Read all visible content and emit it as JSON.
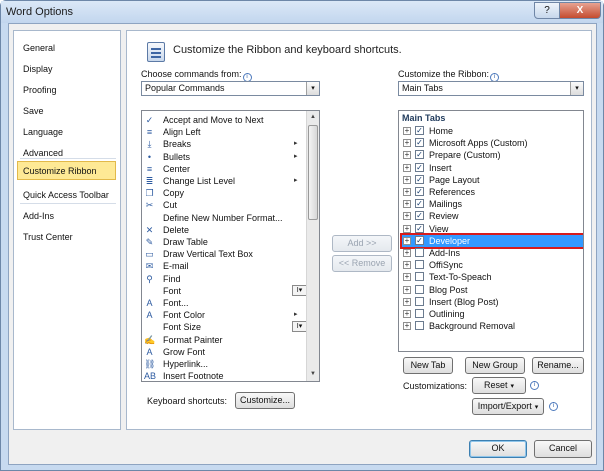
{
  "window": {
    "title": "Word Options",
    "help_glyph": "?",
    "close_glyph": "X"
  },
  "nav": {
    "items": [
      {
        "label": "General"
      },
      {
        "label": "Display"
      },
      {
        "label": "Proofing"
      },
      {
        "label": "Save"
      },
      {
        "label": "Language"
      },
      {
        "label": "Advanced"
      },
      {
        "label": "Customize Ribbon",
        "selected": true
      },
      {
        "label": "Quick Access Toolbar"
      },
      {
        "label": "Add-Ins"
      },
      {
        "label": "Trust Center"
      }
    ]
  },
  "header": {
    "title": "Customize the Ribbon and keyboard shortcuts.",
    "icon": "ribbon-customize-icon"
  },
  "left": {
    "label": "Choose commands from:",
    "info_glyph": "i",
    "selected": "Popular Commands",
    "commands": [
      {
        "label": "Accept and Move to Next",
        "icon": "accept-change-icon",
        "glyph": "✓"
      },
      {
        "label": "Align Left",
        "icon": "align-left-icon",
        "glyph": "≡"
      },
      {
        "label": "Breaks",
        "icon": "breaks-icon",
        "glyph": "⤓",
        "submenu": "▸"
      },
      {
        "label": "Bullets",
        "icon": "bullets-icon",
        "glyph": "•",
        "submenu": "▸"
      },
      {
        "label": "Center",
        "icon": "align-center-icon",
        "glyph": "≡"
      },
      {
        "label": "Change List Level",
        "icon": "list-level-icon",
        "glyph": "≣",
        "submenu": "▸"
      },
      {
        "label": "Copy",
        "icon": "copy-icon",
        "glyph": "❐"
      },
      {
        "label": "Cut",
        "icon": "cut-icon",
        "glyph": "✂"
      },
      {
        "label": "Define New Number Format...",
        "icon": "number-format-icon",
        "glyph": ""
      },
      {
        "label": "Delete",
        "icon": "delete-icon",
        "glyph": "✕"
      },
      {
        "label": "Draw Table",
        "icon": "draw-table-icon",
        "glyph": "✎"
      },
      {
        "label": "Draw Vertical Text Box",
        "icon": "text-box-icon",
        "glyph": "▭"
      },
      {
        "label": "E-mail",
        "icon": "email-icon",
        "glyph": "✉"
      },
      {
        "label": "Find",
        "icon": "find-icon",
        "glyph": "⚲"
      },
      {
        "label": "Font",
        "icon": "font-icon",
        "glyph": "",
        "split": "I▾"
      },
      {
        "label": "Font...",
        "icon": "font-dialog-icon",
        "glyph": "A"
      },
      {
        "label": "Font Color",
        "icon": "font-color-icon",
        "glyph": "A",
        "submenu": "▸"
      },
      {
        "label": "Font Size",
        "icon": "font-size-icon",
        "glyph": "",
        "split": "I▾"
      },
      {
        "label": "Format Painter",
        "icon": "format-painter-icon",
        "glyph": "✍"
      },
      {
        "label": "Grow Font",
        "icon": "grow-font-icon",
        "glyph": "A"
      },
      {
        "label": "Hyperlink...",
        "icon": "hyperlink-icon",
        "glyph": "⛓"
      },
      {
        "label": "Insert Footnote",
        "icon": "footnote-icon",
        "glyph": "AB"
      }
    ]
  },
  "middle": {
    "add": "Add >>",
    "remove": "<< Remove"
  },
  "right": {
    "label": "Customize the Ribbon:",
    "info_glyph": "i",
    "selected": "Main Tabs",
    "tree_header": "Main Tabs",
    "expander_glyph": "+",
    "check_glyph": "✓",
    "tabs": [
      {
        "label": "Home",
        "checked": true
      },
      {
        "label": "Microsoft Apps (Custom)",
        "checked": true
      },
      {
        "label": "Prepare (Custom)",
        "checked": true
      },
      {
        "label": "Insert",
        "checked": true
      },
      {
        "label": "Page Layout",
        "checked": true
      },
      {
        "label": "References",
        "checked": true
      },
      {
        "label": "Mailings",
        "checked": true
      },
      {
        "label": "Review",
        "checked": true
      },
      {
        "label": "View",
        "checked": true
      },
      {
        "label": "Developer",
        "checked": true,
        "selected": true
      },
      {
        "label": "Add-Ins",
        "checked": false
      },
      {
        "label": "OffiSync",
        "checked": false
      },
      {
        "label": "Text-To-Speach",
        "checked": false
      },
      {
        "label": "Blog Post",
        "checked": false
      },
      {
        "label": "Insert (Blog Post)",
        "checked": false
      },
      {
        "label": "Outlining",
        "checked": false
      },
      {
        "label": "Background Removal",
        "checked": false
      }
    ],
    "new_tab": "New Tab",
    "new_group": "New Group",
    "rename": "Rename...",
    "customizations_label": "Customizations:",
    "reset": "Reset",
    "import_export": "Import/Export",
    "dropdown_glyph": "▾"
  },
  "keyboard": {
    "label": "Keyboard shortcuts:",
    "button": "Customize..."
  },
  "footer": {
    "ok": "OK",
    "cancel": "Cancel"
  },
  "colors": {
    "selection": "#3399ff",
    "highlight_border": "#d71b1b",
    "nav_selected": "#fee995"
  }
}
